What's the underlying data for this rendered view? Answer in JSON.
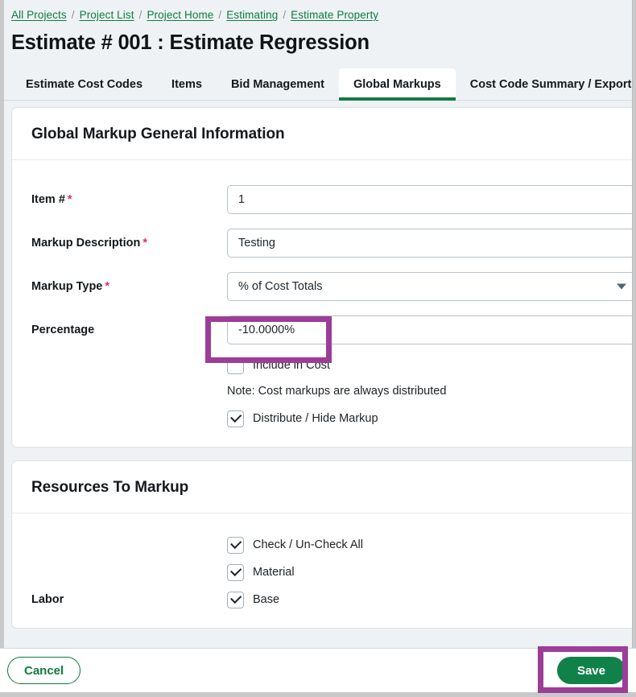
{
  "breadcrumb": {
    "separator": "/",
    "items": [
      {
        "label": "All Projects"
      },
      {
        "label": "Project List"
      },
      {
        "label": "Project Home"
      },
      {
        "label": "Estimating"
      },
      {
        "label": "Estimate Property"
      }
    ]
  },
  "page_title": "Estimate # 001 : Estimate Regression",
  "tabs": [
    {
      "label": "Estimate Cost Codes",
      "active": false
    },
    {
      "label": "Items",
      "active": false
    },
    {
      "label": "Bid Management",
      "active": false
    },
    {
      "label": "Global Markups",
      "active": true
    },
    {
      "label": "Cost Code Summary / Export",
      "active": false
    }
  ],
  "general_section": {
    "title": "Global Markup General Information",
    "fields": {
      "item_number": {
        "label": "Item #",
        "required_marker": "*",
        "value": "1",
        "placeholder": ""
      },
      "markup_description": {
        "label": "Markup Description",
        "required_marker": "*",
        "value": "Testing",
        "placeholder": ""
      },
      "markup_type": {
        "label": "Markup Type",
        "required_marker": "*",
        "value": "% of Cost Totals",
        "options": [
          "% of Cost Totals"
        ],
        "caret_icon": "chevron-down-icon"
      },
      "percentage": {
        "label": "Percentage",
        "required_marker": "",
        "value": "-10.0000%",
        "placeholder": ""
      }
    },
    "include_in_cost": {
      "label": "Include in Cost",
      "checked": false
    },
    "note": "Note: Cost markups are always distributed",
    "distribute_hide_markup": {
      "label": "Distribute / Hide Markup",
      "checked": true
    }
  },
  "resources_section": {
    "title": "Resources To Markup",
    "check_all": {
      "label": "Check / Un-Check All",
      "checked": true
    },
    "material": {
      "label": "Material",
      "checked": true
    },
    "labor": {
      "row_label": "Labor",
      "label": "Base",
      "checked": true
    }
  },
  "footer": {
    "cancel_label": "Cancel",
    "save_label": "Save"
  },
  "colors": {
    "brand_green": "#11814a",
    "link_green": "#0a7c42",
    "active_tab_underline": "#167a41",
    "required_red": "#d9365e",
    "highlight_purple": "#9c3d98",
    "page_background": "#eff2f4",
    "card_background": "#ffffff",
    "input_border": "#b6c2c9"
  },
  "annotations": [
    {
      "name": "percentage-field-highlight",
      "target": "percentage-input"
    },
    {
      "name": "save-button-highlight",
      "target": "save-button"
    }
  ]
}
